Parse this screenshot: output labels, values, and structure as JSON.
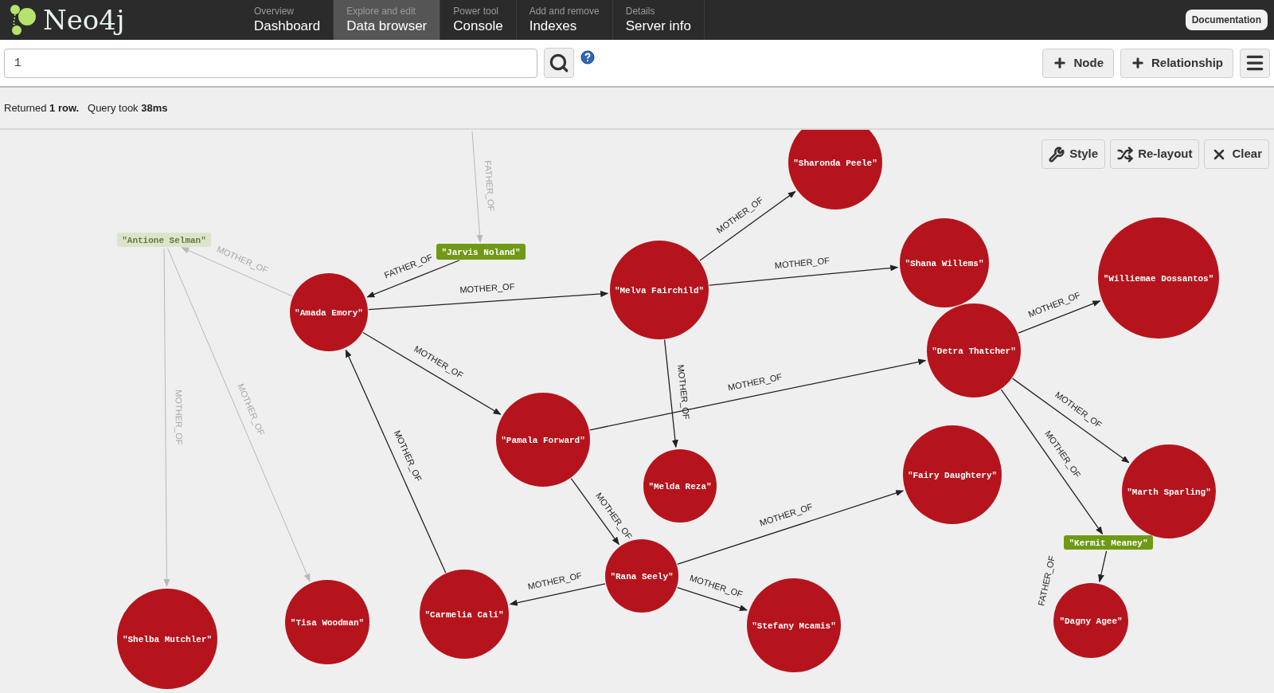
{
  "header": {
    "logo": "Neo4j",
    "nav": [
      {
        "caption": "Overview",
        "label": "Dashboard",
        "selected": false
      },
      {
        "caption": "Explore and edit",
        "label": "Data browser",
        "selected": true
      },
      {
        "caption": "Power tool",
        "label": "Console",
        "selected": false
      },
      {
        "caption": "Add and remove",
        "label": "Indexes",
        "selected": false
      },
      {
        "caption": "Details",
        "label": "Server info",
        "selected": false
      }
    ],
    "documentation_button": "Documentation"
  },
  "toolbar": {
    "query": "1",
    "buttons": [
      {
        "kind": "add",
        "label": "Node"
      },
      {
        "kind": "add",
        "label": "Relationship"
      },
      {
        "kind": "menu"
      }
    ]
  },
  "status": "Returned **1 row.**   Query took **38ms**",
  "graph": {
    "buttons": [
      {
        "kind": "style",
        "label": "Style"
      },
      {
        "kind": "relayout",
        "label": "Re-layout"
      },
      {
        "kind": "clear",
        "label": "Clear"
      }
    ],
    "nodes": [
      {
        "kind": "circle",
        "label": "\"Sharonda Peele\"",
        "faded": false
      },
      {
        "kind": "circle",
        "label": "\"Shana Willems\"",
        "faded": false
      },
      {
        "kind": "circle",
        "label": "\"Williemae Dossantos\"",
        "faded": false
      },
      {
        "kind": "circle",
        "label": "\"Melva Fairchild\"",
        "faded": false
      },
      {
        "kind": "circle",
        "label": "\"Amada Emory\"",
        "faded": false
      },
      {
        "kind": "circle",
        "label": "\"Detra Thatcher\"",
        "faded": false
      },
      {
        "kind": "circle",
        "label": "\"Pamala Forward\"",
        "faded": false
      },
      {
        "kind": "circle",
        "label": "\"Melda Reza\"",
        "faded": false
      },
      {
        "kind": "circle",
        "label": "\"Fairy Daughtery\"",
        "faded": false
      },
      {
        "kind": "circle",
        "label": "\"Marth Sparling\"",
        "faded": false
      },
      {
        "kind": "circle",
        "label": "\"Rana Seely\"",
        "faded": false
      },
      {
        "kind": "circle",
        "label": "\"Stefany Mcamis\"",
        "faded": false
      },
      {
        "kind": "circle",
        "label": "\"Carmelia Cali\"",
        "faded": false
      },
      {
        "kind": "circle",
        "label": "\"Tisa Woodman\"",
        "faded": false
      },
      {
        "kind": "circle",
        "label": "\"Shelba Mutchler\"",
        "faded": false
      },
      {
        "kind": "circle",
        "label": "\"Dagny Agee\"",
        "faded": false
      },
      {
        "kind": "tag",
        "label": "\"Antione Selman\"",
        "faded": true
      },
      {
        "kind": "tag",
        "label": "\"Jarvis Noland\"",
        "faded": false
      },
      {
        "kind": "tag",
        "label": "\"Kermit Meaney\"",
        "faded": false
      }
    ],
    "relationships": [
      {
        "label": "FATHER_OF",
        "faded": true
      },
      {
        "label": "FATHER_OF",
        "faded": false
      },
      {
        "label": "MOTHER_OF",
        "faded": true
      },
      {
        "label": "MOTHER_OF",
        "faded": false
      },
      {
        "label": "MOTHER_OF",
        "faded": false
      },
      {
        "label": "MOTHER_OF",
        "faded": false
      },
      {
        "label": "MOTHER_OF",
        "faded": true
      },
      {
        "label": "MOTHER_OF",
        "faded": true
      },
      {
        "label": "MOTHER_OF",
        "faded": false
      },
      {
        "label": "MOTHER_OF",
        "faded": false
      },
      {
        "label": "MOTHER_OF",
        "faded": false
      },
      {
        "label": "MOTHER_OF",
        "faded": false
      },
      {
        "label": "MOTHER_OF",
        "faded": false
      },
      {
        "label": "MOTHER_OF",
        "faded": false
      },
      {
        "label": "MOTHER_OF",
        "faded": false
      },
      {
        "label": "MOTHER_OF",
        "faded": false
      },
      {
        "label": "MOTHER_OF",
        "faded": false
      },
      {
        "label": "MOTHER_OF",
        "faded": false
      },
      {
        "label": "MOTHER_OF",
        "faded": false
      },
      {
        "label": "FATHER_OF",
        "faded": false
      }
    ]
  }
}
